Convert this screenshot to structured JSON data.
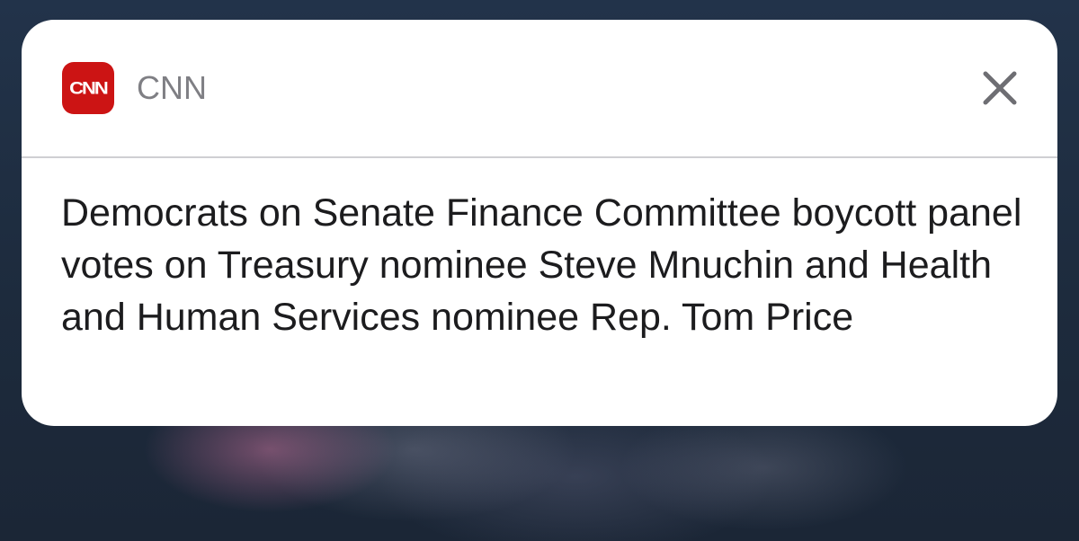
{
  "notification": {
    "app_name": "CNN",
    "app_icon": {
      "name": "cnn-logo-icon",
      "logo_text": "CNN",
      "color": "#cc1414"
    },
    "close_icon": "close-icon",
    "message": "Democrats on Senate Finance Committee boycott panel votes on Treasury nominee Steve Mnuchin and Health and Human Services nominee Rep. Tom Price"
  }
}
